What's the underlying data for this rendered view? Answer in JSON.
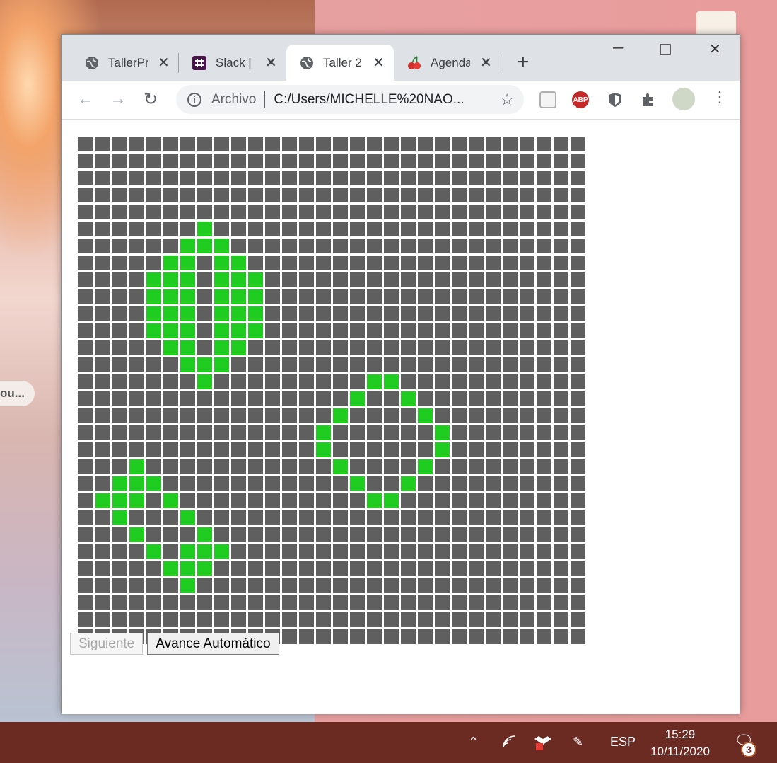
{
  "desktop": {
    "photo_tag": "ou...",
    "accent": "#e99c9c"
  },
  "browser": {
    "tabs": [
      {
        "label": "TallerPr",
        "icon": "globe-icon",
        "active": false
      },
      {
        "label": "Slack | ",
        "icon": "slack-icon",
        "active": false
      },
      {
        "label": "Taller 2",
        "icon": "globe-icon",
        "active": true
      },
      {
        "label": "Agenda",
        "icon": "cherry-icon",
        "active": false
      }
    ],
    "address": {
      "scheme_label": "Archivo",
      "url": "C:/Users/MICHELLE%20NAO..."
    }
  },
  "game": {
    "rows": 30,
    "cols": 30,
    "live_color": "#1fcc1f",
    "dead_color": "#5f5f5f",
    "live_cells": [
      [
        5,
        7
      ],
      [
        6,
        6
      ],
      [
        6,
        7
      ],
      [
        6,
        8
      ],
      [
        7,
        5
      ],
      [
        7,
        6
      ],
      [
        7,
        8
      ],
      [
        7,
        9
      ],
      [
        8,
        4
      ],
      [
        8,
        5
      ],
      [
        8,
        6
      ],
      [
        8,
        8
      ],
      [
        8,
        9
      ],
      [
        8,
        10
      ],
      [
        9,
        4
      ],
      [
        9,
        5
      ],
      [
        9,
        6
      ],
      [
        9,
        8
      ],
      [
        9,
        9
      ],
      [
        9,
        10
      ],
      [
        10,
        4
      ],
      [
        10,
        5
      ],
      [
        10,
        6
      ],
      [
        10,
        8
      ],
      [
        10,
        9
      ],
      [
        10,
        10
      ],
      [
        11,
        4
      ],
      [
        11,
        5
      ],
      [
        11,
        6
      ],
      [
        11,
        8
      ],
      [
        11,
        9
      ],
      [
        11,
        10
      ],
      [
        12,
        5
      ],
      [
        12,
        6
      ],
      [
        12,
        8
      ],
      [
        12,
        9
      ],
      [
        13,
        6
      ],
      [
        13,
        7
      ],
      [
        13,
        8
      ],
      [
        14,
        7
      ],
      [
        14,
        17
      ],
      [
        14,
        18
      ],
      [
        15,
        16
      ],
      [
        15,
        19
      ],
      [
        16,
        15
      ],
      [
        16,
        20
      ],
      [
        17,
        14
      ],
      [
        17,
        21
      ],
      [
        18,
        14
      ],
      [
        18,
        21
      ],
      [
        19,
        15
      ],
      [
        19,
        20
      ],
      [
        20,
        16
      ],
      [
        20,
        19
      ],
      [
        21,
        17
      ],
      [
        21,
        18
      ],
      [
        19,
        3
      ],
      [
        20,
        2
      ],
      [
        20,
        3
      ],
      [
        20,
        4
      ],
      [
        21,
        1
      ],
      [
        21,
        2
      ],
      [
        21,
        3
      ],
      [
        21,
        5
      ],
      [
        22,
        2
      ],
      [
        22,
        6
      ],
      [
        23,
        3
      ],
      [
        23,
        7
      ],
      [
        24,
        4
      ],
      [
        24,
        6
      ],
      [
        24,
        7
      ],
      [
        24,
        8
      ],
      [
        25,
        5
      ],
      [
        25,
        6
      ],
      [
        25,
        7
      ],
      [
        26,
        6
      ]
    ],
    "buttons": {
      "next_label": "Siguiente",
      "auto_label": "Avance Automático"
    }
  },
  "taskbar": {
    "language": "ESP",
    "time": "15:29",
    "date": "10/11/2020",
    "notifications": "3"
  }
}
